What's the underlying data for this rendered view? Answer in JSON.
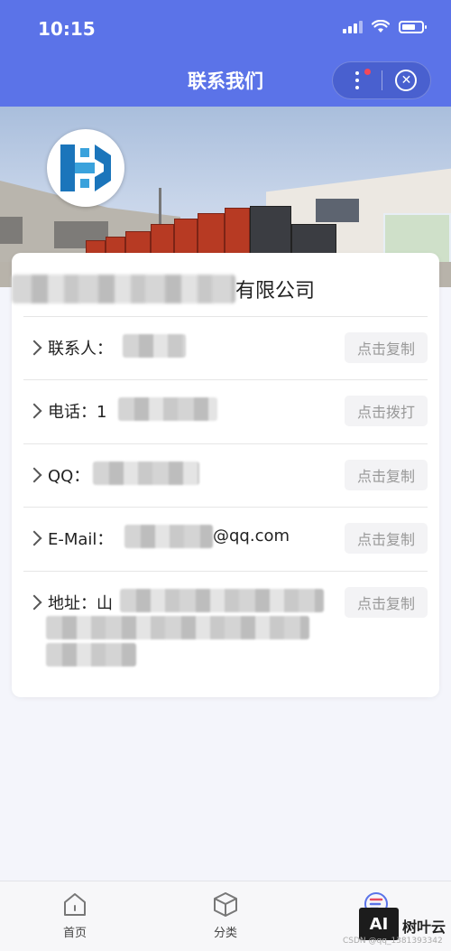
{
  "status_bar": {
    "time": "10:15"
  },
  "nav": {
    "title": "联系我们"
  },
  "company": {
    "name_suffix": "有限公司"
  },
  "contacts": [
    {
      "label": "联系人：",
      "value_suffix": "",
      "action": "点击复制"
    },
    {
      "label": "电话：1",
      "value_suffix": "",
      "action": "点击拨打"
    },
    {
      "label": "QQ：",
      "value_suffix": "",
      "action": "点击复制"
    },
    {
      "label": "E-Mail：",
      "value_suffix": "@qq.com",
      "action": "点击复制"
    },
    {
      "label": "地址：山",
      "value_suffix": "",
      "action": "点击复制"
    }
  ],
  "tabbar": {
    "tabs": [
      {
        "label": "首页",
        "icon": "home-icon"
      },
      {
        "label": "分类",
        "icon": "cube-icon"
      },
      {
        "label": "",
        "icon": "list-icon"
      }
    ]
  },
  "watermark": {
    "badge": "AI",
    "text": "树叶云",
    "csdn": "CSDN @qq_1381393342"
  },
  "colors": {
    "primary": "#5b73e8",
    "background": "#f4f5fb",
    "action_bg": "#f3f3f5",
    "action_text": "#999999"
  }
}
